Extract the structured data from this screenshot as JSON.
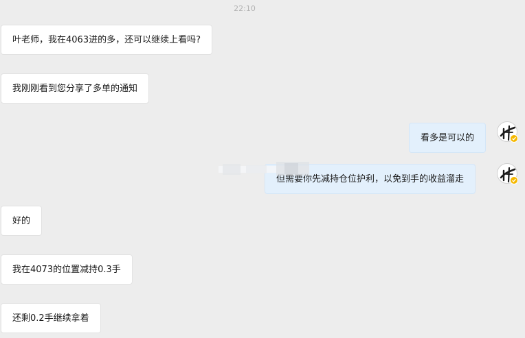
{
  "chat": {
    "timestamp": "22:10",
    "messages": [
      {
        "side": "left",
        "text": "叶老师，我在4063进的多，还可以继续上看吗?"
      },
      {
        "side": "left",
        "text": "我刚刚看到您分享了多单的通知"
      },
      {
        "side": "right",
        "text": "看多是可以的"
      },
      {
        "side": "right",
        "text": "但需要你先减持仓位护利，以免到手的收益溜走"
      },
      {
        "side": "left",
        "text": "好的"
      },
      {
        "side": "left",
        "text": "我在4073的位置减持0.3手"
      },
      {
        "side": "left",
        "text": "还剩0.2手继续拿着"
      }
    ]
  },
  "avatar": {
    "icon": "ink-brush-logo-icon",
    "badge_icon": "verified-check-icon",
    "badge_color": "#f5b800"
  },
  "colors": {
    "background": "#ededed",
    "left_bubble": "#ffffff",
    "right_bubble": "#e3f0fc"
  }
}
